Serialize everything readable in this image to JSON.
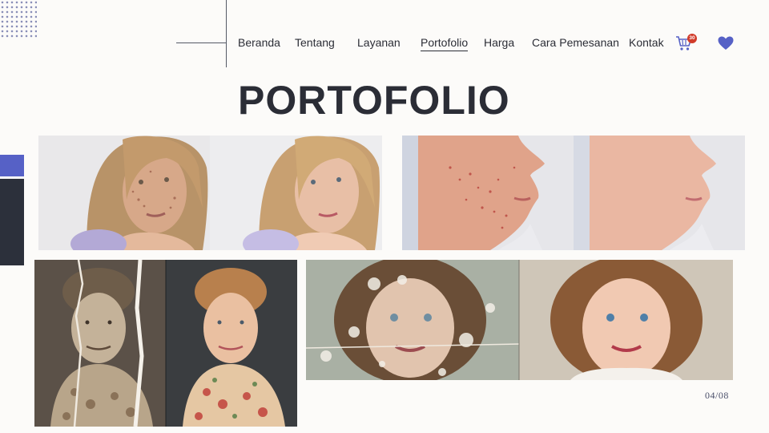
{
  "nav": {
    "items": [
      {
        "label": "Beranda",
        "active": false
      },
      {
        "label": "Tentang",
        "active": false
      },
      {
        "label": "Layanan",
        "active": false
      },
      {
        "label": "Portofolio",
        "active": true
      },
      {
        "label": "Harga",
        "active": false
      },
      {
        "label": "Cara Pemesanan",
        "active": false
      },
      {
        "label": "Kontak",
        "active": false
      }
    ],
    "cart_icon": "cart-icon",
    "cart_count": "30",
    "wishlist_icon": "heart-icon"
  },
  "page": {
    "title": "PORTOFOLIO",
    "page_number": "04/08"
  },
  "gallery": [
    {
      "name": "acne-portrait-before-after"
    },
    {
      "name": "acne-profile-before-after"
    },
    {
      "name": "torn-photo-restoration"
    },
    {
      "name": "child-photo-colorization"
    }
  ],
  "colors": {
    "accent": "#5661c6",
    "dark": "#2c303b",
    "background": "#fcfbf9",
    "badge": "#d13b2a"
  }
}
